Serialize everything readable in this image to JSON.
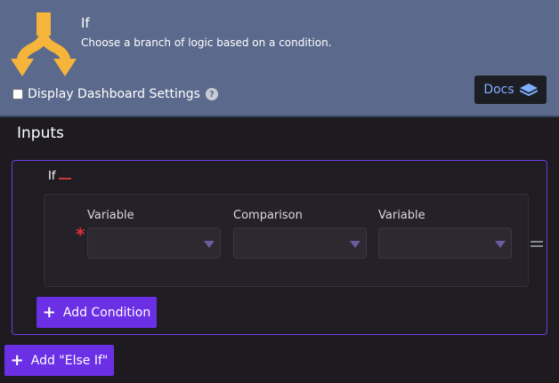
{
  "node": {
    "title": "If",
    "subtitle": "Choose a branch of logic based on a condition.",
    "icon": "fork-icon",
    "icon_color": "#f5b43a",
    "header_color": "#5b6a8c"
  },
  "dashboard": {
    "checkbox_label": "Display Dashboard Settings",
    "checked": false,
    "help_glyph": "?"
  },
  "docs": {
    "label": "Docs",
    "icon": "layers-icon"
  },
  "inputs": {
    "title": "Inputs",
    "if_block": {
      "label": "If",
      "condition": {
        "left_label": "Variable",
        "comparison_label": "Comparison",
        "right_label": "Variable",
        "left_value": "",
        "comparison_value": "",
        "right_value": "",
        "required_marker": "*"
      },
      "add_condition_label": "Add Condition"
    },
    "add_else_if_label": "Add \"Else If\""
  },
  "colors": {
    "accent": "#6b2fe6",
    "border_active": "#6b3fe0",
    "required": "#e0303a"
  }
}
